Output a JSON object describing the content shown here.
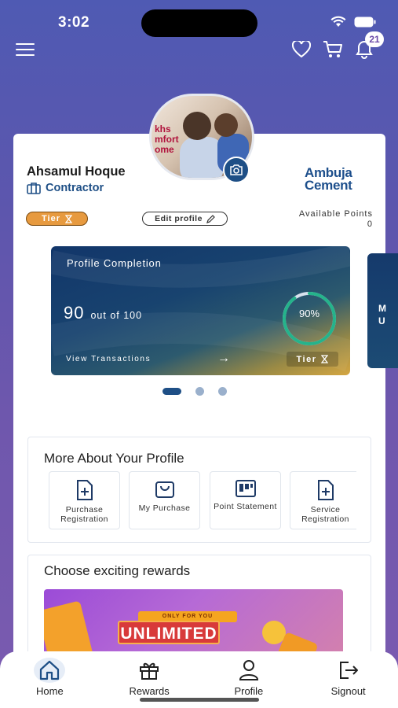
{
  "status_bar": {
    "time": "3:02"
  },
  "header": {
    "notification_count": "21"
  },
  "profile": {
    "name": "Ahsamul Hoque",
    "role": "Contractor",
    "brand_line1": "Ambuja",
    "brand_line2": "Cement",
    "tier_label": "Tier",
    "edit_label": "Edit profile",
    "points_label": "Available Points",
    "points_value": "0",
    "avatar_text_line1": "khs",
    "avatar_text_line2": "mfort",
    "avatar_text_line3": "ome"
  },
  "completion": {
    "title": "Profile Completion",
    "score": "90",
    "score_suffix": "out of 100",
    "percent_label": "90%",
    "percent_value": 0.9,
    "view_label": "View Transactions",
    "arrow": "→",
    "tier_label": "Tier",
    "next_card_line1": "M",
    "next_card_line2": "U"
  },
  "carousel": {
    "page_count": 3,
    "active_index": 0
  },
  "more": {
    "title": "More About Your Profile",
    "tiles": [
      {
        "label": "Purchase Registration",
        "icon": "file-plus-icon"
      },
      {
        "label": "My Purchase",
        "icon": "shopping-bag-icon"
      },
      {
        "label": "Point Statement",
        "icon": "board-icon"
      },
      {
        "label": "Service Registration",
        "icon": "file-plus-icon"
      }
    ]
  },
  "rewards": {
    "title": "Choose exciting rewards",
    "promo_ribbon": "ONLY FOR YOU",
    "promo_text": "UNLIMITED"
  },
  "nav": {
    "items": [
      {
        "label": "Home",
        "icon": "home-icon"
      },
      {
        "label": "Rewards",
        "icon": "gift-icon"
      },
      {
        "label": "Profile",
        "icon": "user-icon"
      },
      {
        "label": "Signout",
        "icon": "signout-icon"
      }
    ]
  },
  "colors": {
    "accent": "#1e4f86",
    "tier": "#e79a3f",
    "background": "#5d56ad"
  }
}
